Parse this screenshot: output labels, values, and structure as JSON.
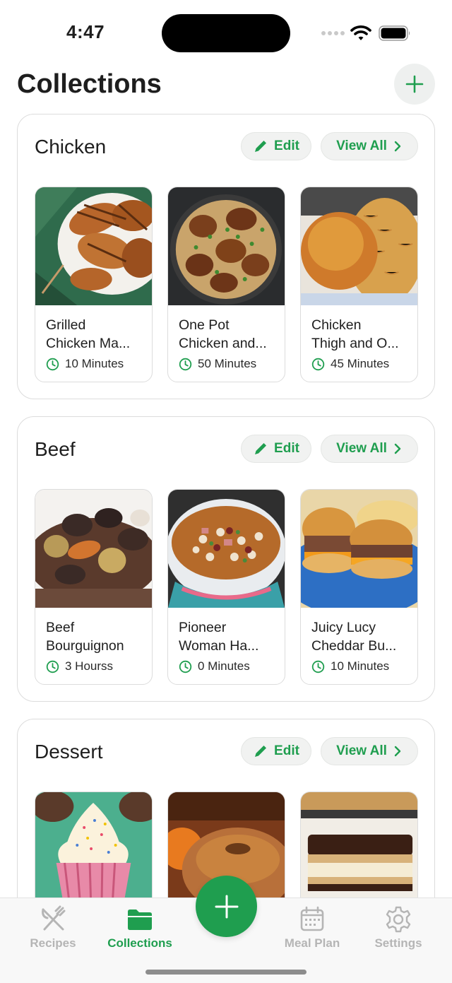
{
  "status": {
    "time": "4:47"
  },
  "header": {
    "title": "Collections",
    "add_icon": "plus-icon"
  },
  "collections": [
    {
      "name": "Chicken",
      "edit_label": "Edit",
      "view_all_label": "View All",
      "recipes": [
        {
          "name_line1": "Grilled",
          "name_line2": "Chicken Ma...",
          "time": "10 Minutes"
        },
        {
          "name_line1": "One Pot",
          "name_line2": "Chicken and...",
          "time": "50 Minutes"
        },
        {
          "name_line1": "Chicken",
          "name_line2": "Thigh and O...",
          "time": "45 Minutes"
        }
      ]
    },
    {
      "name": "Beef",
      "edit_label": "Edit",
      "view_all_label": "View All",
      "recipes": [
        {
          "name_line1": "Beef",
          "name_line2": "Bourguignon",
          "time": "3 Hourss"
        },
        {
          "name_line1": "Pioneer",
          "name_line2": "Woman Ha...",
          "time": "0 Minutes"
        },
        {
          "name_line1": "Juicy Lucy",
          "name_line2": "Cheddar Bu...",
          "time": "10 Minutes"
        }
      ]
    },
    {
      "name": "Dessert",
      "edit_label": "Edit",
      "view_all_label": "View All",
      "recipes": [
        {
          "name_line1": "",
          "name_line2": "",
          "time": ""
        },
        {
          "name_line1": "",
          "name_line2": "",
          "time": ""
        },
        {
          "name_line1": "",
          "name_line2": "",
          "time": ""
        }
      ]
    }
  ],
  "tabs": [
    {
      "label": "Recipes",
      "icon": "fork-knife-icon",
      "active": false
    },
    {
      "label": "Collections",
      "icon": "folder-icon",
      "active": true
    },
    {
      "label": "Meal Plan",
      "icon": "calendar-icon",
      "active": false
    },
    {
      "label": "Settings",
      "icon": "gear-icon",
      "active": false
    }
  ],
  "colors": {
    "accent": "#1f9e4f",
    "inactive_tab": "#b5b5b5",
    "pill_bg": "#f1f2f1"
  }
}
